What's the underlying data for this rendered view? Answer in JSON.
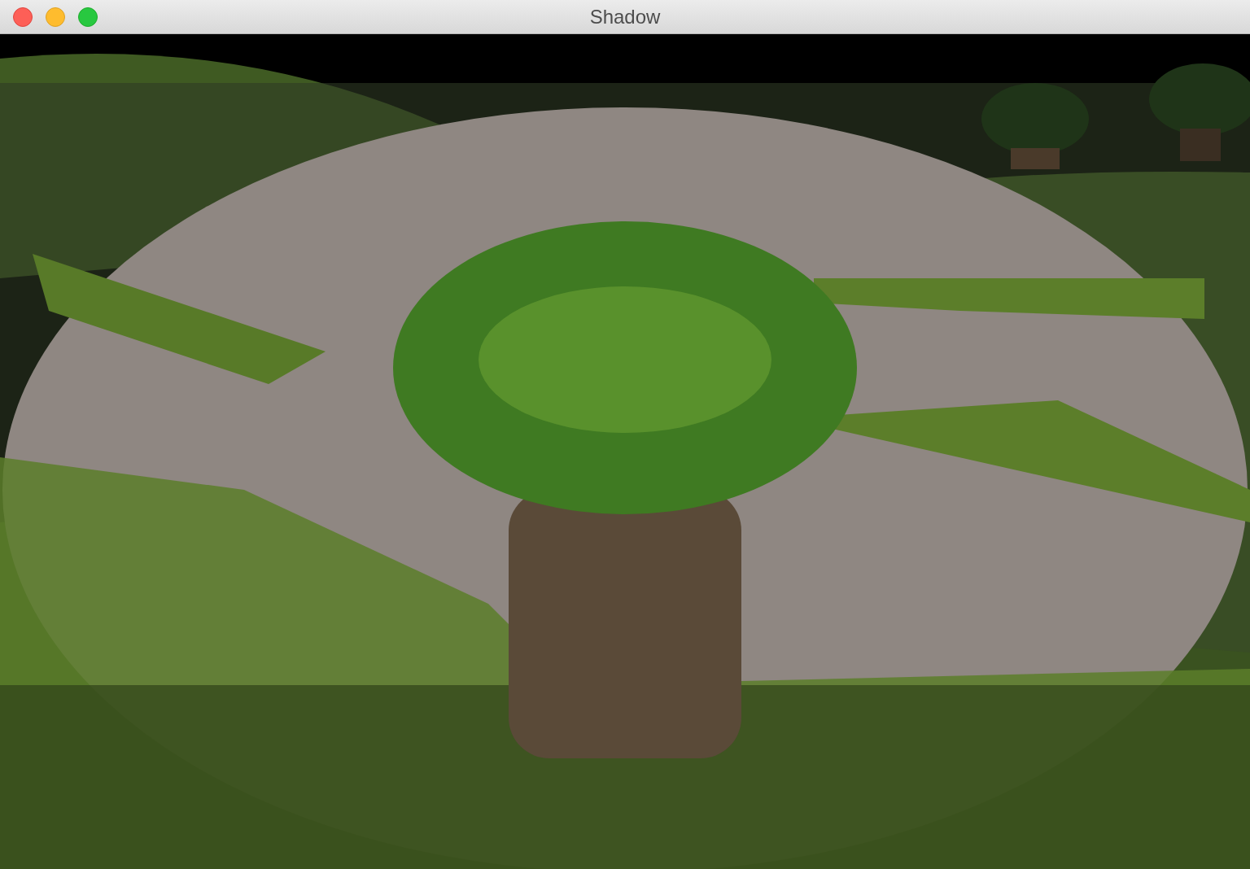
{
  "window": {
    "title": "Shadow"
  }
}
